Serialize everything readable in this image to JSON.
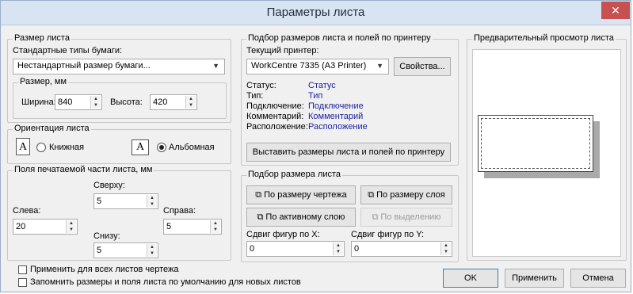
{
  "window": {
    "title": "Параметры листа",
    "close": "✕"
  },
  "paper_size": {
    "group_title": "Размер листа",
    "std_label": "Стандартные типы бумаги:",
    "std_value": "Нестандартный размер бумаги...",
    "size_group": "Размер, мм",
    "width_label": "Ширина:",
    "width_value": "840",
    "height_label": "Высота:",
    "height_value": "420"
  },
  "orientation": {
    "group_title": "Ориентация листа",
    "portrait_icon": "A",
    "portrait_label": "Книжная",
    "landscape_icon": "A",
    "landscape_label": "Альбомная",
    "selected": "landscape"
  },
  "margins": {
    "group_title": "Поля печатаемой части листа, мм",
    "top_label": "Сверху:",
    "top_value": "5",
    "left_label": "Слева:",
    "left_value": "20",
    "right_label": "Справа:",
    "right_value": "5",
    "bottom_label": "Снизу:",
    "bottom_value": "5"
  },
  "printer": {
    "group_title": "Подбор размеров листа и полей по принтеру",
    "current_label": "Текущий принтер:",
    "current_value": "WorkCentre 7335 (A3 Printer)",
    "properties_button": "Свойства...",
    "info": [
      {
        "key": "Статус:",
        "value": "Статус"
      },
      {
        "key": "Тип:",
        "value": "Тип"
      },
      {
        "key": "Подключение:",
        "value": "Подключение"
      },
      {
        "key": "Комментарий:",
        "value": "Комментарий"
      },
      {
        "key": "Расположение:",
        "value": "Расположение"
      }
    ],
    "fit_button": "Выставить размеры листа и полей по принтеру"
  },
  "fit": {
    "group_title": "Подбор размера листа",
    "by_drawing": "По размеру чертежа",
    "by_layer": "По размеру слоя",
    "by_active_layer": "По активному слою",
    "by_selection": "По выделению",
    "shift_x_label": "Сдвиг фигур по X:",
    "shift_x_value": "0",
    "shift_y_label": "Сдвиг фигур по Y:",
    "shift_y_value": "0"
  },
  "preview": {
    "group_title": "Предварительный просмотр листа"
  },
  "footer": {
    "apply_all": "Применить для всех листов чертежа",
    "remember": "Запомнить размеры и поля листа по умолчанию для новых листов",
    "ok": "OK",
    "apply": "Применить",
    "cancel": "Отмена"
  },
  "icons": {
    "dropdown": "chevron-down-icon",
    "spin": "spin-arrows-icon",
    "fit_drawing": "fit-drawing-icon",
    "fit_layer": "fit-layer-icon",
    "fit_active": "fit-active-layer-icon",
    "fit_selection": "fit-selection-icon"
  },
  "colors": {
    "link": "#1a1f9e",
    "titlebar": "#d8e4f2",
    "close": "#c75050"
  }
}
